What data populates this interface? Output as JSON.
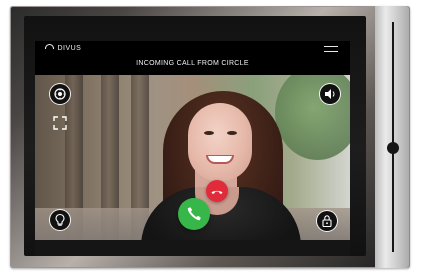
{
  "brand": {
    "text": "DIVUS"
  },
  "header": {
    "title": "INCOMING CALL FROM CIRCLE"
  },
  "icons": {
    "menu": "hamburger-menu-icon",
    "camera": "camera-settings-icon",
    "fullscreen": "fullscreen-icon",
    "volume": "speaker-volume-icon",
    "light": "lightbulb-icon",
    "lock": "lock-icon",
    "answer": "phone-answer-icon",
    "hangup": "phone-hangup-icon"
  },
  "colors": {
    "answer": "#37b64a",
    "hangup": "#e12b3b",
    "bar": "#000000",
    "frame": "#b7b0ab"
  }
}
